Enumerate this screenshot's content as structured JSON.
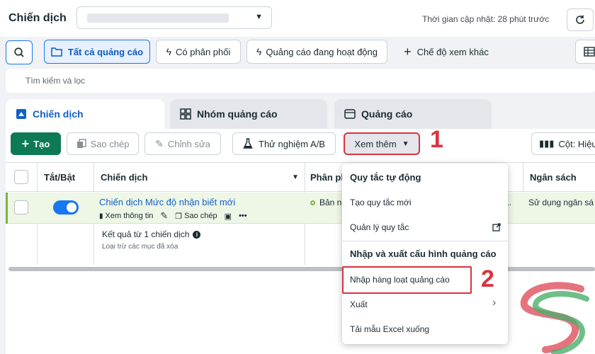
{
  "header": {
    "page_title": "Chiến dịch",
    "update_time": "Thời gian cập nhật: 28 phút trước"
  },
  "filters": {
    "all_ads": "Tất cả quảng cáo",
    "has_delivery": "Có phân phối",
    "active_ads": "Quảng cáo đang hoạt động",
    "other_views": "Chế độ xem khác",
    "search_placeholder": "Tìm kiếm và lọc"
  },
  "level_tabs": {
    "campaign": "Chiến dịch",
    "adset": "Nhóm quảng cáo",
    "ad": "Quảng cáo"
  },
  "toolbar": {
    "create": "Tạo",
    "copy": "Sao chép",
    "edit": "Chỉnh sửa",
    "ab_test": "Thử nghiệm A/B",
    "more": "Xem thêm",
    "columns": "Cột: Hiệu"
  },
  "table": {
    "headers": {
      "toggle": "Tắt/Bật",
      "campaign": "Chiến dịch",
      "delivery": "Phân ph",
      "budget": "Ngân sách"
    },
    "row": {
      "name": "Chiến dịch Mức độ nhận biết mới",
      "view_info": "Xem thông tin",
      "copy": "Sao chép",
      "more": "•••",
      "delivery": "Bản n",
      "ellipsis": "...",
      "budget": "Sử dụng ngân sá"
    },
    "result": "Kết quả từ 1 chiến dịch",
    "result_sub": "Loại trừ các mục đã xóa"
  },
  "dropdown": {
    "section1": "Quy tắc tự động",
    "create_rule": "Tạo quy tắc mới",
    "manage_rules": "Quản lý quy tắc",
    "section2": "Nhập và xuất cấu hình quảng cáo",
    "bulk_import": "Nhập hàng loạt quảng cáo",
    "export": "Xuất",
    "download_template": "Tải mẫu Excel xuống"
  },
  "annotations": {
    "step1": "1",
    "step2": "2"
  },
  "colors": {
    "accent": "#1877f2",
    "create_green": "#0e7a55",
    "annotation_red": "#d9333e",
    "selected_row": "#eef6e6"
  }
}
